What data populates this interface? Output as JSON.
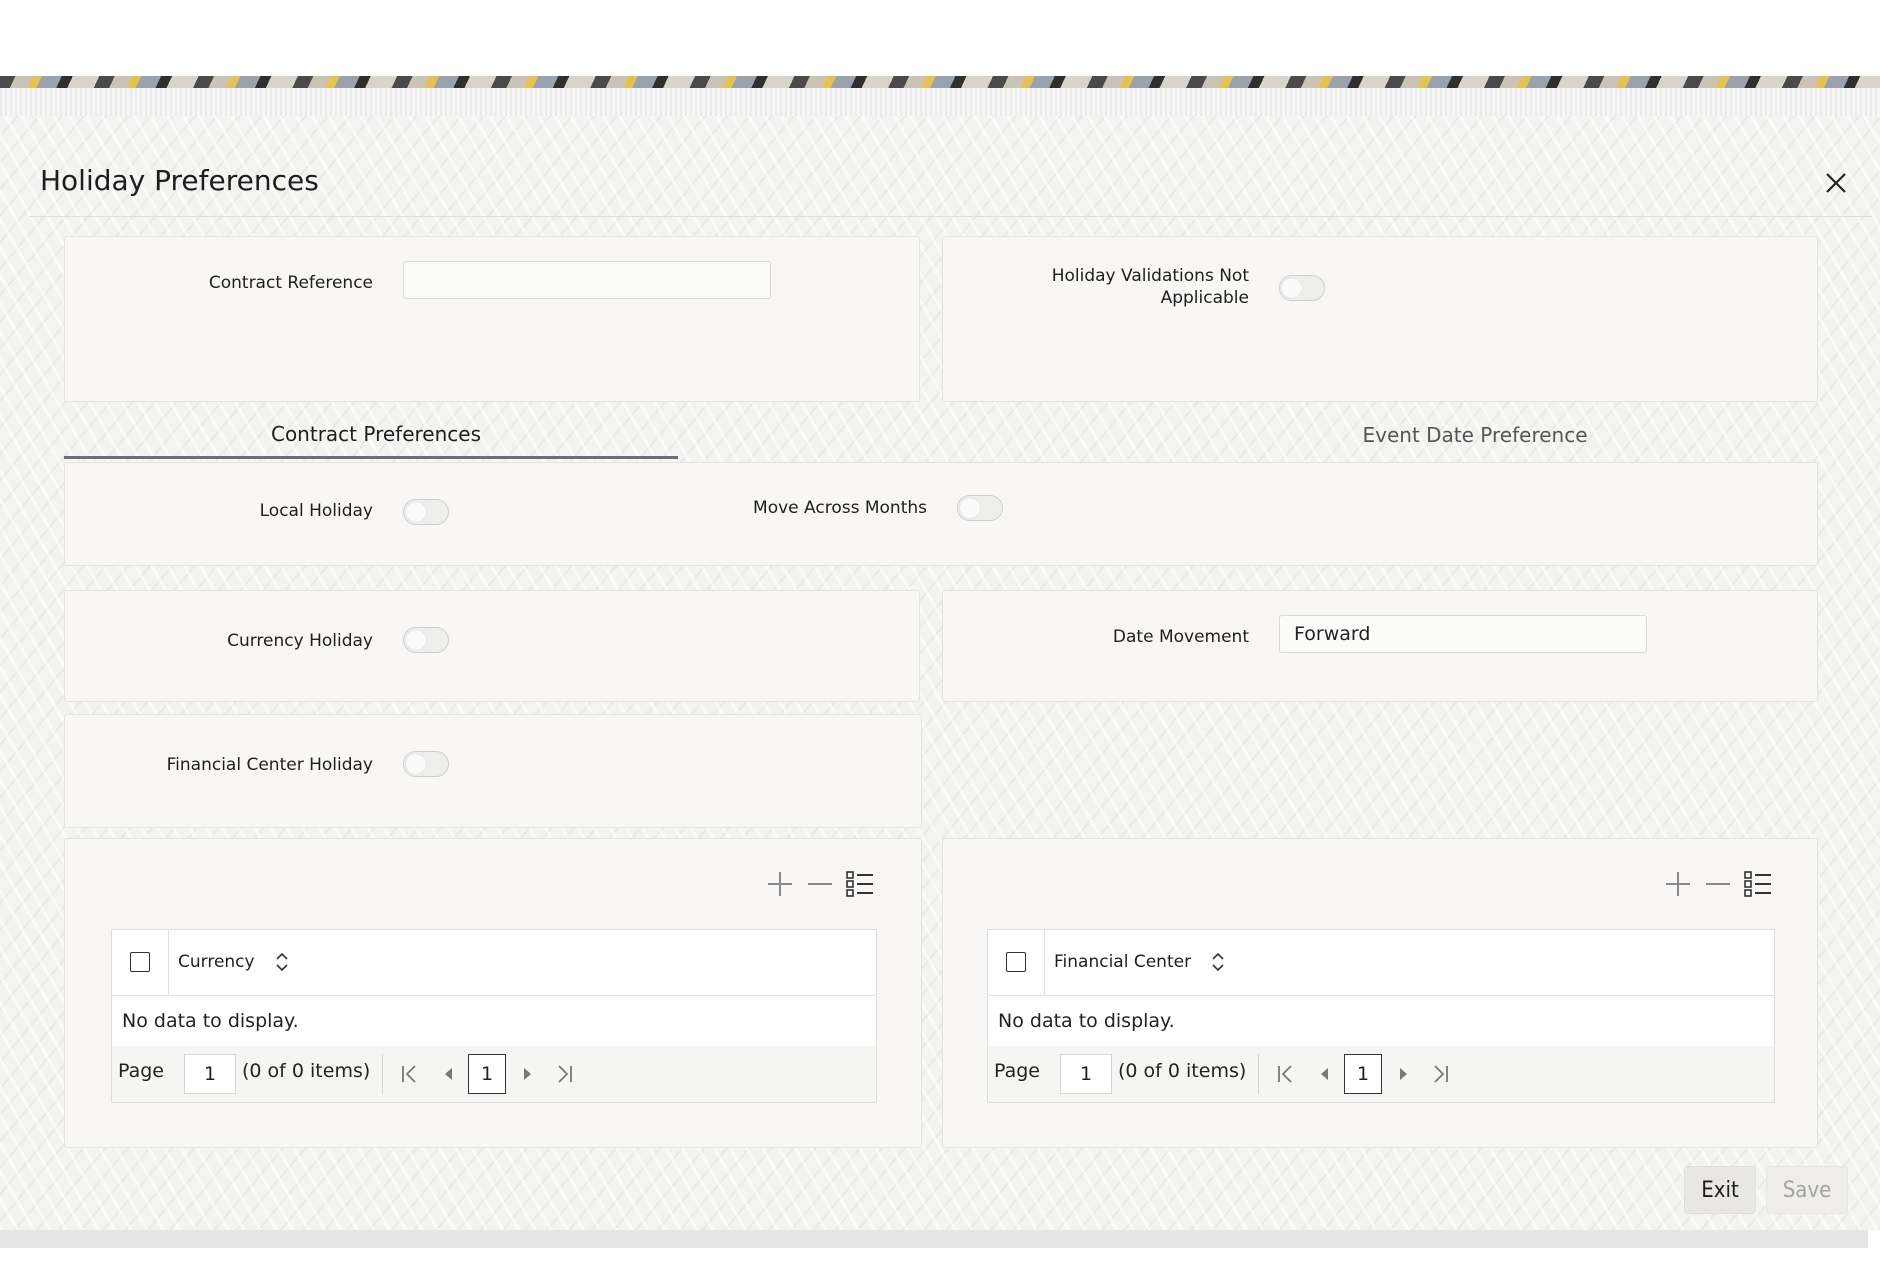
{
  "window": {
    "title": "Holiday Preferences",
    "close_icon": "close-icon"
  },
  "header": {
    "contract_reference_label": "Contract Reference",
    "contract_reference_value": "",
    "holiday_validations_label_line1": "Holiday Validations Not",
    "holiday_validations_label_line2": "Applicable",
    "holiday_validations_on": false
  },
  "tabs": [
    {
      "label": "Contract Preferences",
      "active": true
    },
    {
      "label": "Event Date Preference",
      "active": false
    }
  ],
  "contract_preferences": {
    "local_holiday_label": "Local Holiday",
    "local_holiday_on": false,
    "move_across_months_label": "Move Across Months",
    "move_across_months_on": false,
    "currency_holiday_label": "Currency Holiday",
    "currency_holiday_on": false,
    "date_movement_label": "Date Movement",
    "date_movement_value": "Forward",
    "financial_center_holiday_label": "Financial Center Holiday",
    "financial_center_holiday_on": false
  },
  "currency_grid": {
    "column": "Currency",
    "empty_text": "No data to display.",
    "page_label": "Page",
    "page_value": "1",
    "items_text": "(0 of 0 items)",
    "current_page": "1"
  },
  "financial_center_grid": {
    "column": "Financial Center",
    "empty_text": "No data to display.",
    "page_label": "Page",
    "page_value": "1",
    "items_text": "(0 of 0 items)",
    "current_page": "1"
  },
  "footer": {
    "exit_label": "Exit",
    "save_label": "Save"
  },
  "colors": {
    "tab_underline": "#6b6f7c",
    "panel": "#f8f7f5",
    "disabled_text": "#a3a3a0"
  }
}
